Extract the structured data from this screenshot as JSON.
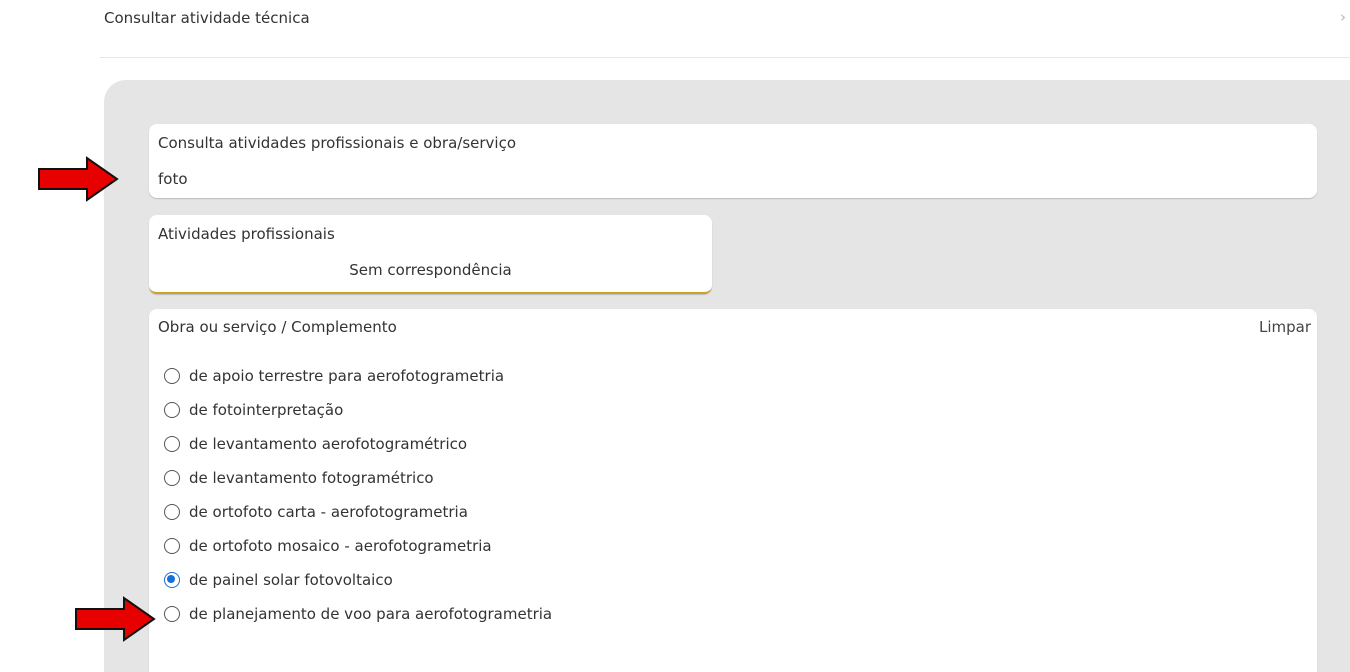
{
  "header": {
    "title": "Consultar atividade técnica",
    "close_symbol": "›"
  },
  "search": {
    "label": "Consulta atividades profissionais e obra/serviço",
    "value": "foto"
  },
  "atividades": {
    "label": "Atividades profissionais",
    "empty_text": "Sem correspondência"
  },
  "obra": {
    "label": "Obra ou serviço / Complemento",
    "clear_label": "Limpar",
    "options": [
      {
        "label": "de apoio terrestre para aerofotogrametria",
        "checked": false
      },
      {
        "label": "de fotointerpretação",
        "checked": false
      },
      {
        "label": "de levantamento aerofotogramétrico",
        "checked": false
      },
      {
        "label": "de levantamento fotogramétrico",
        "checked": false
      },
      {
        "label": "de ortofoto carta - aerofotogrametria",
        "checked": false
      },
      {
        "label": "de ortofoto mosaico - aerofotogrametria",
        "checked": false
      },
      {
        "label": "de painel solar fotovoltaico",
        "checked": true
      },
      {
        "label": "de planejamento de voo para aerofotogrametria",
        "checked": false
      }
    ]
  },
  "annotations": {
    "arrow_color": "#e60000",
    "arrow_icon": "red-arrow-icon"
  },
  "colors": {
    "radio_selected": "#1a6fd6",
    "panel_bg": "#e5e5e5",
    "accent_underline": "#c9a227"
  }
}
